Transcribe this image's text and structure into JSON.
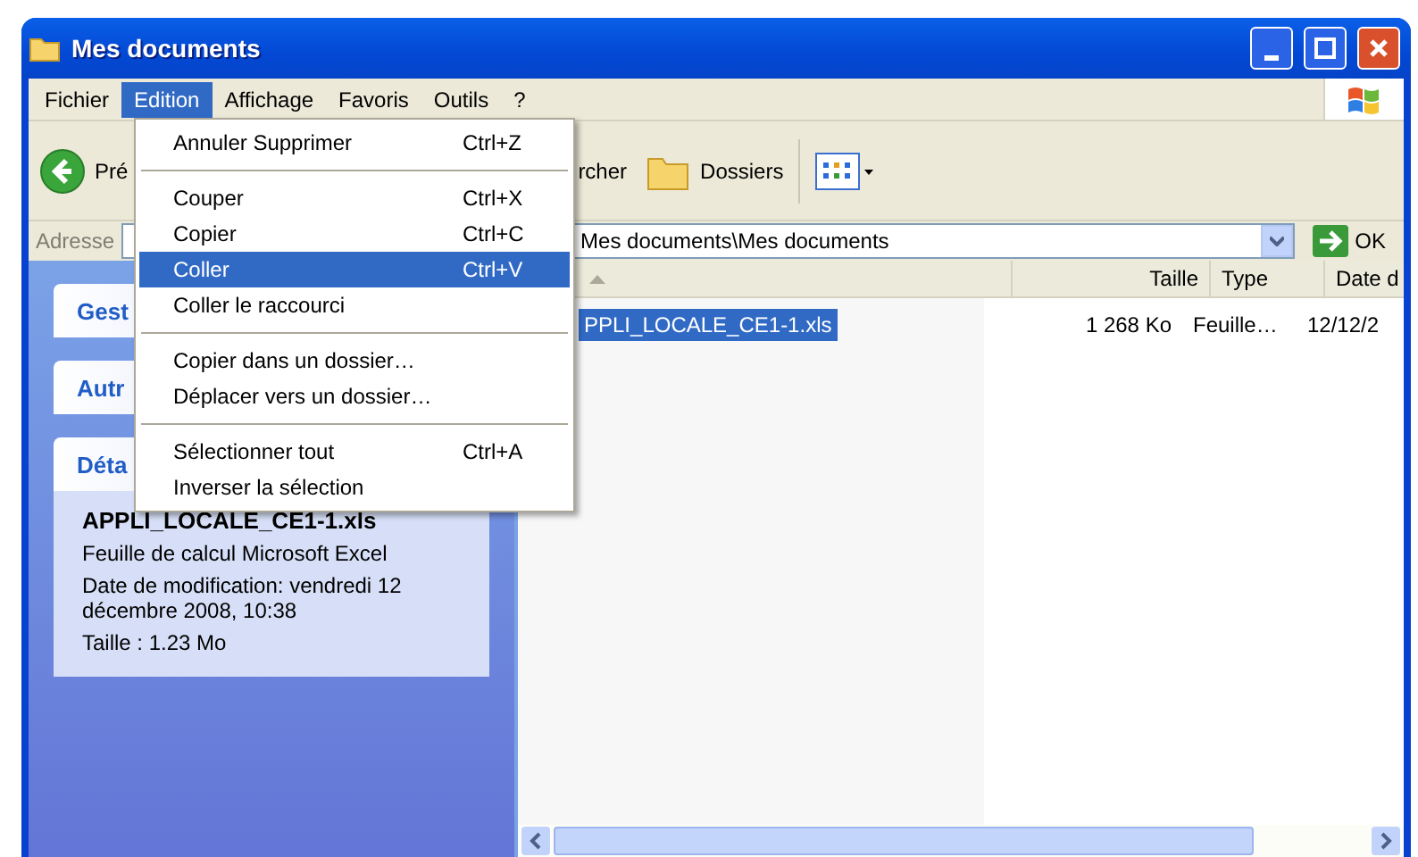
{
  "window": {
    "title": "Mes documents"
  },
  "menu_bar": [
    {
      "label": "Fichier",
      "selected": false
    },
    {
      "label": "Edition",
      "selected": true
    },
    {
      "label": "Affichage",
      "selected": false
    },
    {
      "label": "Favoris",
      "selected": false
    },
    {
      "label": "Outils",
      "selected": false
    },
    {
      "label": "?",
      "selected": false
    }
  ],
  "toolbar": {
    "back": "Pré",
    "search": "rcher",
    "folders": "Dossiers"
  },
  "address": {
    "label": "Adresse",
    "value": "Mes documents\\Mes documents",
    "go": "OK"
  },
  "edit_menu": [
    {
      "kind": "item",
      "label": "Annuler Supprimer",
      "shortcut": "Ctrl+Z",
      "selected": false
    },
    {
      "kind": "separator"
    },
    {
      "kind": "item",
      "label": "Couper",
      "shortcut": "Ctrl+X",
      "selected": false
    },
    {
      "kind": "item",
      "label": "Copier",
      "shortcut": "Ctrl+C",
      "selected": false
    },
    {
      "kind": "item",
      "label": "Coller",
      "shortcut": "Ctrl+V",
      "selected": true
    },
    {
      "kind": "item",
      "label": "Coller le raccourci",
      "selected": false
    },
    {
      "kind": "separator"
    },
    {
      "kind": "item",
      "label": "Copier dans un dossier…",
      "selected": false
    },
    {
      "kind": "item",
      "label": "Déplacer vers un dossier…",
      "selected": false
    },
    {
      "kind": "separator"
    },
    {
      "kind": "item",
      "label": "Sélectionner tout",
      "shortcut": "Ctrl+A",
      "selected": false
    },
    {
      "kind": "item",
      "label": "Inverser la sélection",
      "selected": false
    }
  ],
  "sidebar": {
    "panels": [
      {
        "title": "Gest"
      },
      {
        "title": "Autr"
      },
      {
        "title": "Déta",
        "details": {
          "name": "APPLI_LOCALE_CE1-1.xls",
          "type": "Feuille de calcul Microsoft Excel",
          "modified": "Date de modification: vendredi 12 décembre 2008, 10:38",
          "size": "Taille : 1.23 Mo"
        }
      }
    ]
  },
  "table": {
    "columns": [
      "Taille",
      "Type",
      "Date d"
    ],
    "rows": [
      {
        "name": "PPLI_LOCALE_CE1-1.xls",
        "size": "1 268 Ko",
        "type": "Feuille…",
        "date": "12/12/2",
        "selected": true
      }
    ]
  }
}
